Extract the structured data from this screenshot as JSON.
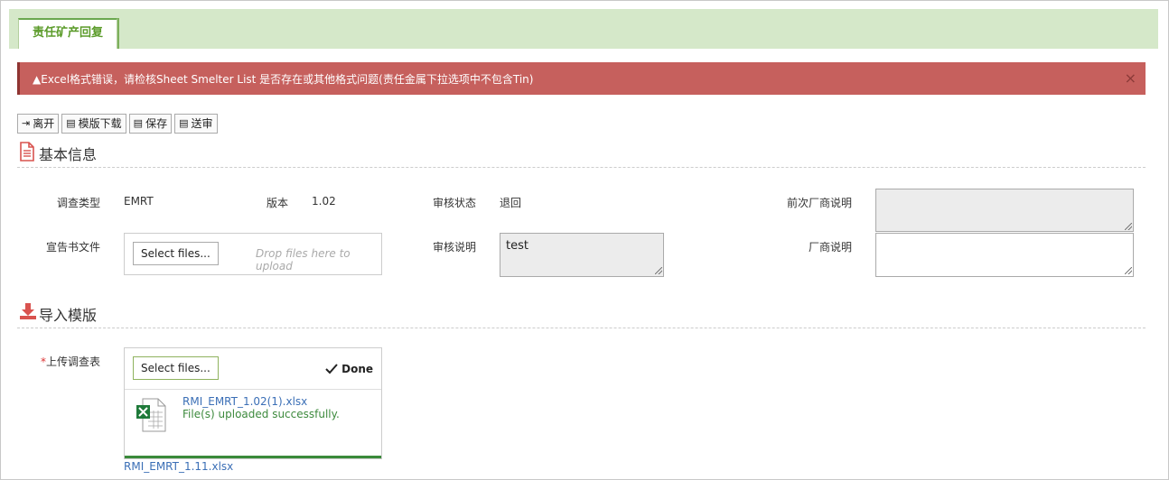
{
  "tab": {
    "label": "责任矿产回复"
  },
  "alert": {
    "message": "Excel格式错误，请检核Sheet Smelter List 是否存在或其他格式问题(责任金属下拉选项中不包含Tin)",
    "close": "×"
  },
  "toolbar": {
    "leave": "离开",
    "download": "模版下载",
    "save": "保存",
    "submit": "送审"
  },
  "basic": {
    "title": "基本信息",
    "survey_type_label": "调查类型",
    "survey_type_value": "EMRT",
    "version_label": "版本",
    "version_value": "1.02",
    "review_status_label": "审核状态",
    "review_status_value": "退回",
    "prev_vendor_note_label": "前次厂商说明",
    "prev_vendor_note_value": "",
    "declaration_label": "宣告书文件",
    "select_files": "Select files...",
    "drop_hint": "Drop files here to upload",
    "review_note_label": "审核说明",
    "review_note_value": "test",
    "vendor_note_label": "厂商说明",
    "vendor_note_value": ""
  },
  "import": {
    "title": "导入模版",
    "required_mark": "*",
    "upload_label": "上传调查表",
    "select_files": "Select files...",
    "done": "Done",
    "file_name": "RMI_EMRT_1.02(1).xlsx",
    "file_status": "File(s) uploaded successfully.",
    "upload_progress": 1.0,
    "existing_file": "RMI_EMRT_1.11.xlsx"
  }
}
